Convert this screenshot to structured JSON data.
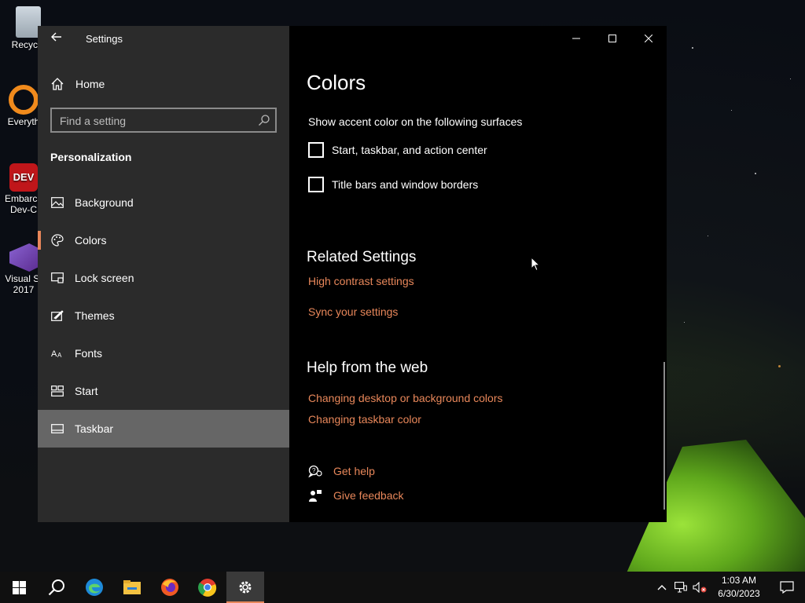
{
  "theme": {
    "accent": "#e8875a",
    "sidebar_bg": "#2b2b2b",
    "selected_bg": "#666666"
  },
  "desktop": {
    "icons": [
      {
        "label": "Recycle",
        "icon": "recycle-bin-icon"
      },
      {
        "label": "Everyth",
        "icon": "everything-icon"
      },
      {
        "label": "Embarca",
        "label2": "Dev-C",
        "icon": "dev-cpp-icon"
      },
      {
        "label": "Visual St",
        "label2": "2017",
        "icon": "visual-studio-icon"
      }
    ]
  },
  "window": {
    "title": "Settings",
    "controls": {
      "minimize": "minimize-icon",
      "maximize": "maximize-icon",
      "close": "close-icon"
    }
  },
  "sidebar": {
    "home_label": "Home",
    "search_placeholder": "Find a setting",
    "section_title": "Personalization",
    "items": [
      {
        "label": "Background",
        "icon": "picture-icon"
      },
      {
        "label": "Colors",
        "icon": "palette-icon"
      },
      {
        "label": "Lock screen",
        "icon": "lock-screen-icon"
      },
      {
        "label": "Themes",
        "icon": "themes-icon"
      },
      {
        "label": "Fonts",
        "icon": "fonts-icon"
      },
      {
        "label": "Start",
        "icon": "start-icon"
      },
      {
        "label": "Taskbar",
        "icon": "taskbar-icon"
      }
    ]
  },
  "main": {
    "title": "Colors",
    "accent_surfaces_label": "Show accent color on the following surfaces",
    "checkboxes": [
      {
        "label": "Start, taskbar, and action center",
        "checked": false
      },
      {
        "label": "Title bars and window borders",
        "checked": false
      }
    ],
    "related": {
      "heading": "Related Settings",
      "links": [
        "High contrast settings",
        "Sync your settings"
      ]
    },
    "help": {
      "heading": "Help from the web",
      "links": [
        "Changing desktop or background colors",
        "Changing taskbar color"
      ]
    },
    "support": [
      {
        "label": "Get help",
        "icon": "get-help-icon"
      },
      {
        "label": "Give feedback",
        "icon": "feedback-icon"
      }
    ]
  },
  "taskbar": {
    "apps": [
      "start-icon",
      "search-icon",
      "edge-icon",
      "file-explorer-icon",
      "firefox-icon",
      "chrome-icon",
      "settings-gear-icon"
    ],
    "clock": {
      "time": "1:03 AM",
      "date": "6/30/2023"
    }
  }
}
